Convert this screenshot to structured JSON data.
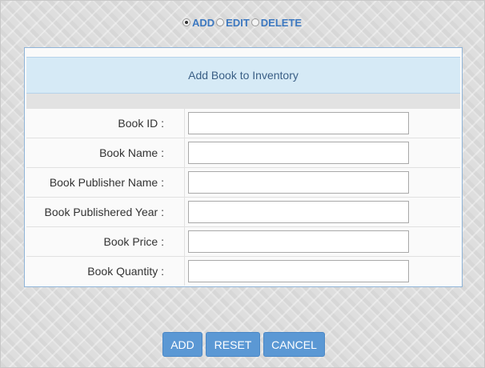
{
  "mode_selector": {
    "options": [
      {
        "label": "ADD",
        "checked": true
      },
      {
        "label": "EDIT",
        "checked": false
      },
      {
        "label": "DELETE",
        "checked": false
      }
    ]
  },
  "form": {
    "title": "Add Book to Inventory",
    "fields": [
      {
        "label": "Book ID :",
        "value": ""
      },
      {
        "label": "Book Name :",
        "value": ""
      },
      {
        "label": "Book Publisher Name :",
        "value": ""
      },
      {
        "label": "Book Publishered Year :",
        "value": ""
      },
      {
        "label": "Book Price :",
        "value": ""
      },
      {
        "label": "Book Quantity :",
        "value": ""
      }
    ]
  },
  "actions": {
    "add_label": "ADD",
    "reset_label": "RESET",
    "cancel_label": "CANCEL"
  },
  "colors": {
    "accent": "#3c78c0",
    "button": "#5b98d4",
    "header_bg": "#d6eaf6"
  }
}
